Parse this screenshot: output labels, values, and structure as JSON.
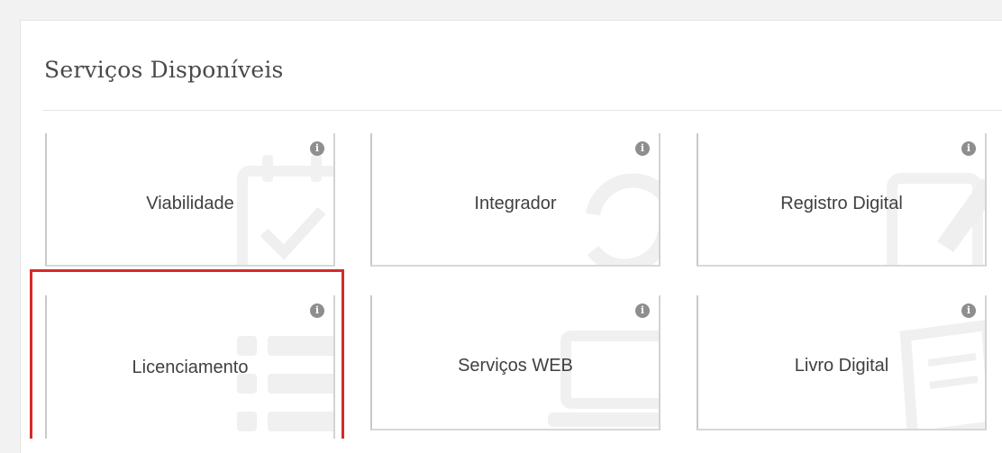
{
  "panel": {
    "title": "Serviços Disponíveis"
  },
  "services": [
    {
      "label": "Viabilidade",
      "info_icon": "info-icon",
      "bg_icon": "calendar-check-icon"
    },
    {
      "label": "Integrador",
      "info_icon": "info-icon",
      "bg_icon": "refresh-icon"
    },
    {
      "label": "Registro Digital",
      "info_icon": "info-icon",
      "bg_icon": "edit-icon"
    },
    {
      "label": "Licenciamento",
      "info_icon": "info-icon",
      "bg_icon": "list-icon",
      "highlighted": true
    },
    {
      "label": "Serviços WEB",
      "info_icon": "info-icon",
      "bg_icon": "laptop-icon"
    },
    {
      "label": "Livro Digital",
      "info_icon": "info-icon",
      "bg_icon": "book-icon"
    }
  ],
  "info_glyph": "i",
  "colors": {
    "highlight_border": "#d42a2a",
    "info_icon_bg": "#8e8e8e",
    "text": "#404040"
  }
}
